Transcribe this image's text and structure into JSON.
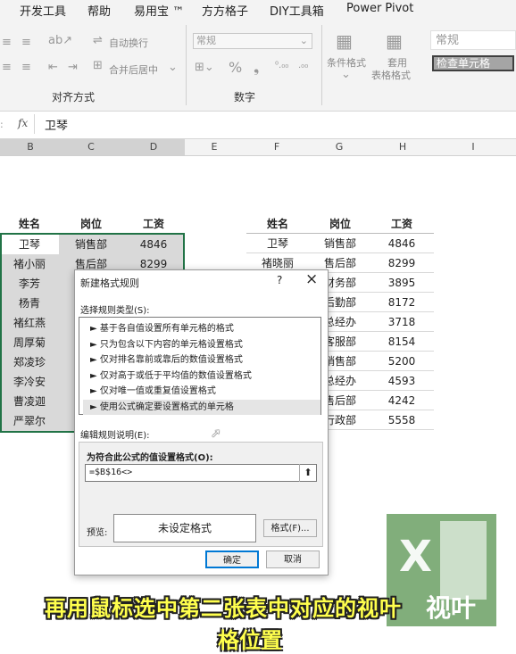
{
  "ribbon": {
    "tabs": [
      "开发工具",
      "帮助",
      "易用宝 ™",
      "方方格子",
      "DIY工具箱",
      "Power Pivot"
    ],
    "wrap_text": "自动换行",
    "merge_center": "合并后居中",
    "number_format": "常规",
    "conditional_format": "条件格式",
    "table_format_1": "套用",
    "table_format_2": "表格格式",
    "style_normal": "常规",
    "style_check": "检查单元格",
    "group_alignment": "对齐方式",
    "group_number": "数字"
  },
  "formula_bar": {
    "fx": "fx",
    "value": "卫琴"
  },
  "columns": [
    "B",
    "C",
    "D",
    "E",
    "F",
    "G",
    "H",
    "I"
  ],
  "table1": {
    "headers": [
      "姓名",
      "岗位",
      "工资"
    ],
    "rows": [
      [
        "卫琴",
        "销售部",
        "4846"
      ],
      [
        "褚小丽",
        "售后部",
        "8299"
      ],
      [
        "李芳",
        "",
        ""
      ],
      [
        "杨青",
        "",
        ""
      ],
      [
        "褚红燕",
        "",
        ""
      ],
      [
        "周厚菊",
        "",
        ""
      ],
      [
        "郑凌珍",
        "",
        ""
      ],
      [
        "李冷安",
        "",
        ""
      ],
      [
        "曹凌迦",
        "",
        ""
      ],
      [
        "严翠尔",
        "",
        ""
      ]
    ]
  },
  "table2": {
    "headers": [
      "姓名",
      "岗位",
      "工资"
    ],
    "rows": [
      [
        "卫琴",
        "销售部",
        "4846"
      ],
      [
        "褚晓丽",
        "售后部",
        "8299"
      ],
      [
        "",
        "财务部",
        "3895"
      ],
      [
        "",
        "后勤部",
        "8172"
      ],
      [
        "",
        "总经办",
        "3718"
      ],
      [
        "",
        "客服部",
        "8154"
      ],
      [
        "",
        "销售部",
        "5200"
      ],
      [
        "",
        "总经办",
        "4593"
      ],
      [
        "",
        "售后部",
        "4242"
      ],
      [
        "",
        "行政部",
        "5558"
      ]
    ]
  },
  "dialog": {
    "title": "新建格式规则",
    "help": "?",
    "close": "×",
    "select_type_label": "选择规则类型(S):",
    "rules": [
      "► 基于各自值设置所有单元格的格式",
      "► 只为包含以下内容的单元格设置格式",
      "► 仅对排名靠前或靠后的数值设置格式",
      "► 仅对高于或低于平均值的数值设置格式",
      "► 仅对唯一值或重复值设置格式",
      "► 使用公式确定要设置格式的单元格"
    ],
    "selected_rule": 5,
    "edit_label": "编辑规则说明(E):",
    "formula_label": "为符合此公式的值设置格式(O):",
    "formula_value": "=$B$16<>",
    "preview_label": "预览:",
    "preview_text": "未设定格式",
    "format_button": "格式(F)...",
    "ok_button": "确定",
    "cancel_button": "取消"
  },
  "logo": {
    "letter": "X",
    "text": "视叶"
  },
  "subtitle": {
    "line1": "再用鼠标选中第二张表中对应的视叶",
    "line2": "格位置"
  }
}
